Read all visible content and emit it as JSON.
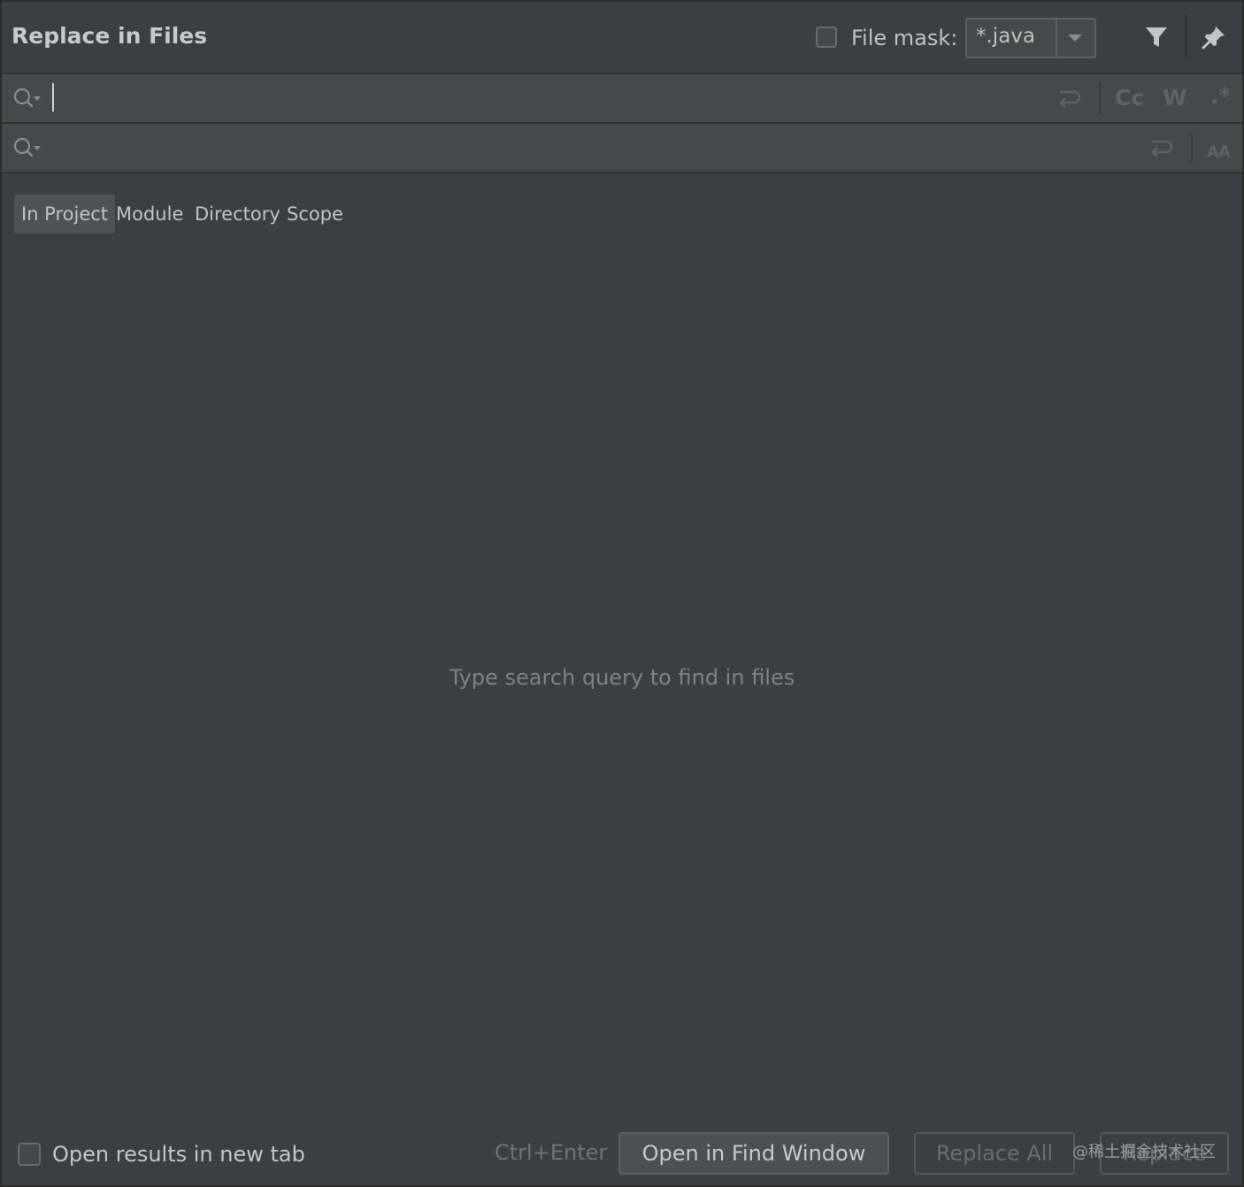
{
  "header": {
    "title": "Replace in Files",
    "file_mask_label": "File mask:",
    "file_mask_value": "*.java",
    "file_mask_checked": false,
    "filter_icon": "filter-icon",
    "pin_icon": "pin-icon"
  },
  "search": {
    "find_value": "",
    "replace_value": "",
    "match_case_label": "Cc",
    "words_label": "W",
    "regex_label": ".*"
  },
  "scope": {
    "tabs": [
      {
        "label": "In Project",
        "selected": true
      },
      {
        "label": "Module",
        "selected": false
      },
      {
        "label": "Directory",
        "selected": false
      },
      {
        "label": "Scope",
        "selected": false
      }
    ]
  },
  "results": {
    "empty_hint": "Type search query to find in files"
  },
  "footer": {
    "open_new_tab_label": "Open results in new tab",
    "shortcut": "Ctrl+Enter",
    "open_find_window_label": "Open in Find Window",
    "replace_all_label": "Replace All",
    "replace_label": "Replace",
    "watermark": "@稀土掘金技术社区"
  },
  "colors": {
    "background": "#3c3f41",
    "input_background": "#45494a",
    "border": "#323232",
    "hint_text": "#7e8285"
  }
}
